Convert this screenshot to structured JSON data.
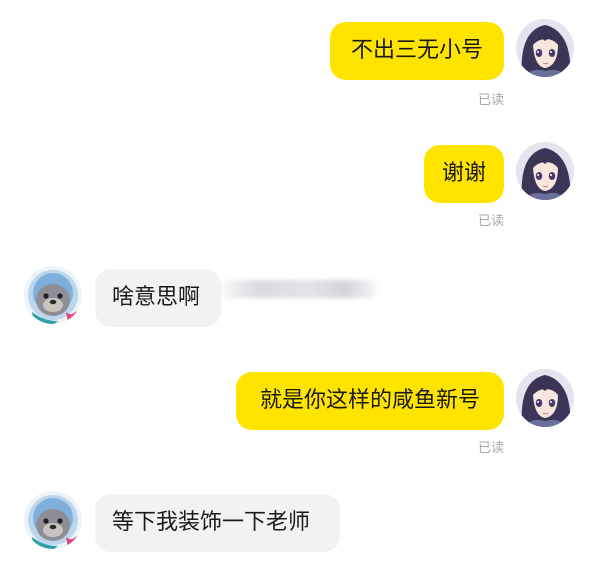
{
  "messages": [
    {
      "side": "me",
      "text": "不出三无小号",
      "status": "已读"
    },
    {
      "side": "me",
      "text": "谢谢",
      "status": "已读"
    },
    {
      "side": "them",
      "text": "啥意思啊"
    },
    {
      "side": "me",
      "text": "就是你这样的咸鱼新号",
      "status": "已读"
    },
    {
      "side": "them",
      "text": "等下我装饰一下老师"
    }
  ],
  "colors": {
    "my_bubble": "#ffe400",
    "their_bubble": "#f2f2f3",
    "read_status": "#a8a8a8"
  },
  "icons": {
    "my_avatar": "anime-girl-avatar-icon",
    "their_avatar": "seal-avatar-icon"
  }
}
